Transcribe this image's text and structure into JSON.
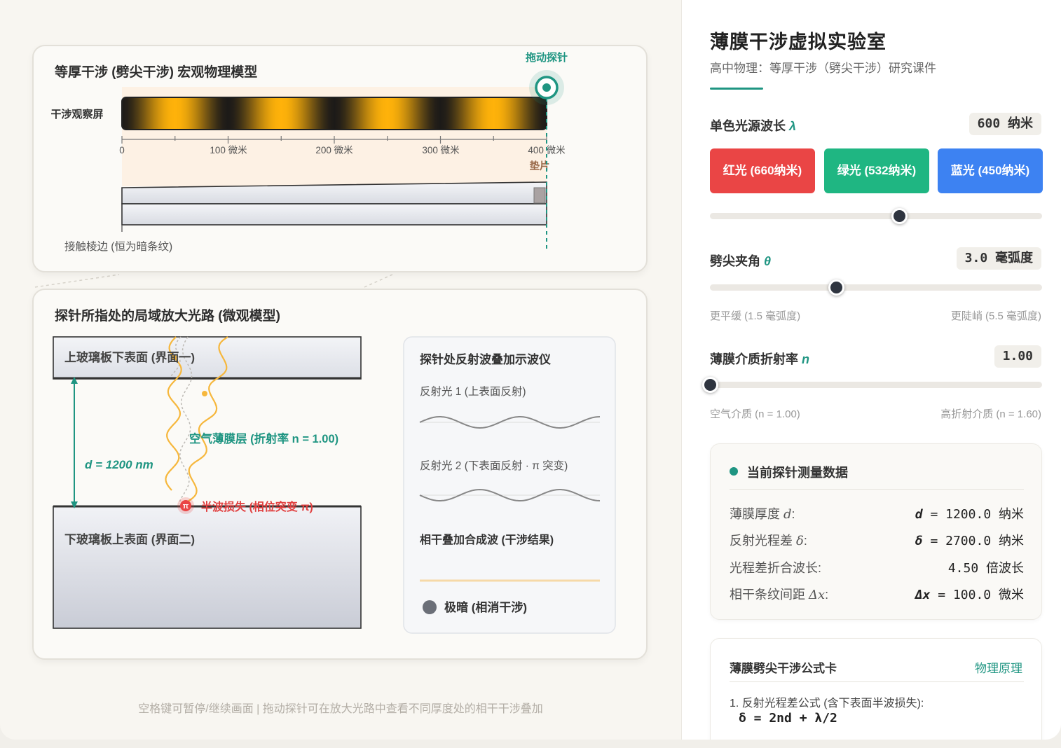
{
  "macro": {
    "title": "等厚干涉 (劈尖干涉) 宏观物理模型",
    "screen_label": "干涉观察屏",
    "probe_label": "拖动探针",
    "ticks": [
      "0",
      "100 微米",
      "200 微米",
      "300 微米",
      "400 微米"
    ],
    "spacer_label": "垫片",
    "edge_label": "接触棱边 (恒为暗条纹)",
    "fringe_color": "#ffb20a"
  },
  "micro": {
    "title": "探针所指处的局域放大光路 (微观模型)",
    "upper_plate_label": "上玻璃板下表面 (界面一)",
    "lower_plate_label": "下玻璃板上表面 (界面二)",
    "thickness_label": "d = 1200 nm",
    "air_layer_label": "空气薄膜层 (折射率 n = 1.00)",
    "half_wave_label": "半波损失 (相位突变 π)",
    "pi_symbol": "π"
  },
  "scope": {
    "title": "探针处反射波叠加示波仪",
    "wave1_label": "反射光 1 (上表面反射)",
    "wave2_label": "反射光 2 (下表面反射 · π 突变)",
    "sum_label": "相干叠加合成波 (干涉结果)",
    "result_label": "极暗 (相消干涉)"
  },
  "footer_hint": "空格键可暂停/继续画面 | 拖动探针可在放大光路中查看不同厚度处的相干干涉叠加",
  "panel": {
    "title": "薄膜干涉虚拟实验室",
    "subtitle": "高中物理：等厚干涉（劈尖干涉）研究课件",
    "wavelength": {
      "label": "单色光源波长",
      "symbol": "λ",
      "value": "600 纳米",
      "slider_fraction": 0.57,
      "buttons": [
        {
          "label": "红光 (660纳米)",
          "color": "#ea4545"
        },
        {
          "label": "绿光 (532纳米)",
          "color": "#1fb682"
        },
        {
          "label": "蓝光 (450纳米)",
          "color": "#3d82f2"
        }
      ]
    },
    "angle": {
      "label": "劈尖夹角",
      "symbol": "θ",
      "value": "3.0 毫弧度",
      "slider_fraction": 0.38,
      "min_hint": "更平缓 (1.5 毫弧度)",
      "max_hint": "更陡峭 (5.5 毫弧度)"
    },
    "index": {
      "label": "薄膜介质折射率",
      "symbol": "n",
      "value": "1.00",
      "slider_fraction": 0.0,
      "min_hint": "空气介质 (n = 1.00)",
      "max_hint": "高折射介质 (n = 1.60)"
    },
    "data": {
      "title": "当前探针测量数据",
      "rows": [
        {
          "label": "薄膜厚度 ",
          "sym": "d",
          "value_sym": "d",
          "value": " = 1200.0 纳米"
        },
        {
          "label": "反射光程差 ",
          "sym": "δ",
          "value_sym": "δ",
          "value": " = 2700.0 纳米"
        },
        {
          "label": "光程差折合波长:",
          "sym": "",
          "value_sym": "",
          "value": "4.50 倍波长"
        },
        {
          "label": "相干条纹间距 ",
          "sym": "Δx",
          "value_sym": "Δx",
          "value": " = 100.0 微米"
        }
      ]
    },
    "formula": {
      "title": "薄膜劈尖干涉公式卡",
      "tag": "物理原理",
      "line1": "1. 反射光程差公式 (含下表面半波损失):",
      "line2": "δ = 2nd + λ/2"
    }
  }
}
